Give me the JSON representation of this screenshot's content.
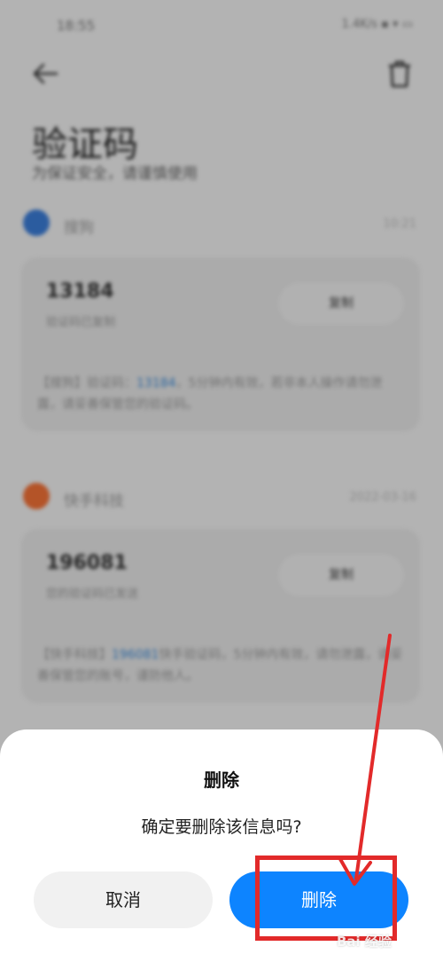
{
  "status_bar": {
    "time": "18:55",
    "indicators": "1.4K/s ▪ ▾ ▭"
  },
  "header": {
    "back_icon": "back-arrow-icon",
    "trash_icon": "trash-icon",
    "title": "验证码",
    "subtitle": "为保证安全，请谨慎使用"
  },
  "messages": [
    {
      "sender": "搜狗",
      "time": "10:21",
      "code": "13184",
      "code_hint": "验证码已复制",
      "copy_label": "复制",
      "body_before": "【搜狗】验证码：",
      "body_code": "13184",
      "body_after": "，5分钟内有效，若非本人操作请勿泄露，请妥善保管您的验证码。",
      "icon_color": "#3a7bd5"
    },
    {
      "sender": "快手科技",
      "time": "2022-03-16",
      "code": "196081",
      "code_hint": "您的验证码已发送",
      "copy_label": "复制",
      "body_before": "【快手科技】",
      "body_code": "196081",
      "body_after": "快手验证码，5分钟内有效，请勿泄露，请妥善保管您的账号，谨防他人。",
      "icon_color": "#f07036"
    }
  ],
  "dialog": {
    "title": "删除",
    "message": "确定要删除该信息吗?",
    "cancel_label": "取消",
    "delete_label": "删除"
  },
  "annotation": {
    "color": "#e22a2a"
  },
  "watermark": "Bai 经验"
}
